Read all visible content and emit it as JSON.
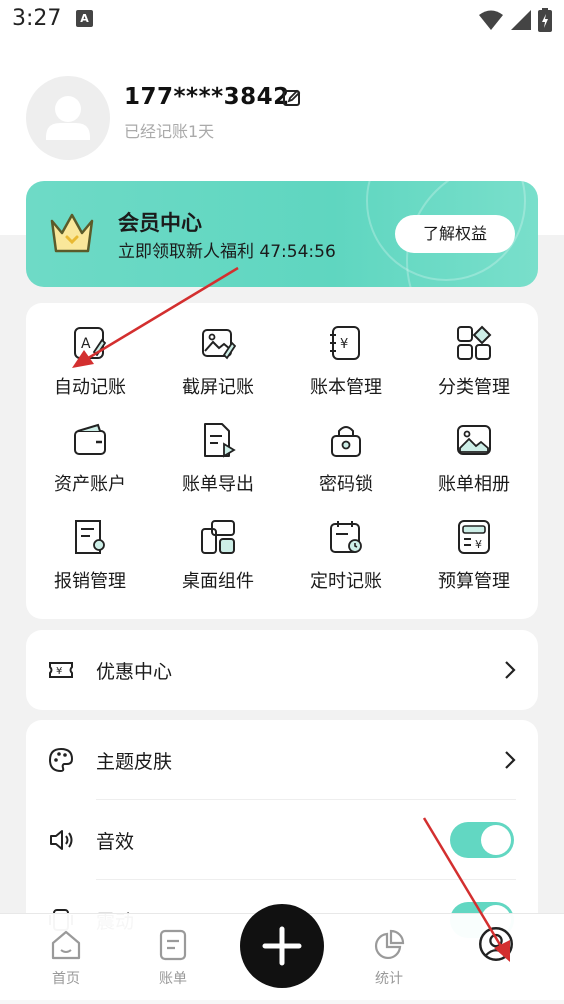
{
  "status_bar": {
    "time": "3:27",
    "notif_letter": "A"
  },
  "profile": {
    "phone": "177****3842",
    "days_text": "已经记账1天"
  },
  "vip": {
    "title": "会员中心",
    "subtitle": "立即领取新人福利 47:54:56",
    "button": "了解权益"
  },
  "tools": [
    {
      "label": "自动记账",
      "icon": "auto-bookkeeping-icon"
    },
    {
      "label": "截屏记账",
      "icon": "screenshot-bookkeeping-icon"
    },
    {
      "label": "账本管理",
      "icon": "ledger-management-icon"
    },
    {
      "label": "分类管理",
      "icon": "category-management-icon"
    },
    {
      "label": "资产账户",
      "icon": "wallet-icon"
    },
    {
      "label": "账单导出",
      "icon": "bill-export-icon"
    },
    {
      "label": "密码锁",
      "icon": "password-lock-icon"
    },
    {
      "label": "账单相册",
      "icon": "bill-album-icon"
    },
    {
      "label": "报销管理",
      "icon": "reimbursement-icon"
    },
    {
      "label": "桌面组件",
      "icon": "desktop-widget-icon"
    },
    {
      "label": "定时记账",
      "icon": "scheduled-bookkeeping-icon"
    },
    {
      "label": "预算管理",
      "icon": "budget-icon"
    }
  ],
  "rows": {
    "coupon": "优惠中心",
    "theme": "主题皮肤",
    "sound": "音效",
    "vibration": "震动"
  },
  "toggles": {
    "sound": true,
    "vibration": true
  },
  "nav": {
    "home": "首页",
    "bills": "账单",
    "stats": "统计"
  },
  "colors": {
    "accent": "#62d7c2",
    "annotation_arrow": "#d32f2f"
  }
}
